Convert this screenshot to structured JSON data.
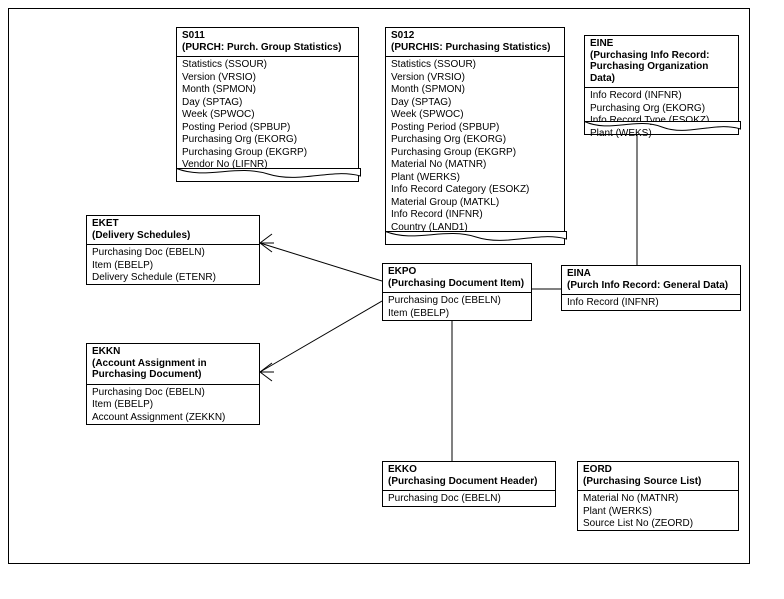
{
  "entities": {
    "s011": {
      "code": "S011",
      "title": "(PURCH: Purch. Group Statistics)",
      "fields": [
        "Statistics (SSOUR)",
        "Version (VRSIO)",
        "Month (SPMON)",
        "Day (SPTAG)",
        "Week (SPWOC)",
        "Posting Period (SPBUP)",
        "Purchasing Org (EKORG)",
        "Purchasing Group (EKGRP)",
        "Vendor No (LIFNR)"
      ]
    },
    "s012": {
      "code": "S012",
      "title": "(PURCHIS: Purchasing Statistics)",
      "fields": [
        "Statistics (SSOUR)",
        "Version (VRSIO)",
        "Month (SPMON)",
        "Day (SPTAG)",
        "Week (SPWOC)",
        "Posting Period (SPBUP)",
        "Purchasing Org (EKORG)",
        "Purchasing Group (EKGRP)",
        "Material No (MATNR)",
        "Plant (WERKS)",
        "Info Record Category (ESOKZ)",
        "Material Group (MATKL)",
        "Info Record (INFNR)",
        "Country (LAND1)"
      ]
    },
    "eine": {
      "code": "EINE",
      "title": "(Purchasing Info Record: Purchasing Organization Data)",
      "fields": [
        "Info Record (INFNR)",
        "Purchasing Org (EKORG)",
        "Info Record Type (ESOKZ)",
        "Plant (WEKS)"
      ]
    },
    "eket": {
      "code": "EKET",
      "title": "(Delivery Schedules)",
      "fields": [
        "Purchasing Doc (EBELN)",
        "Item (EBELP)",
        "Delivery Schedule (ETENR)"
      ]
    },
    "ekpo": {
      "code": "EKPO",
      "title": "(Purchasing Document Item)",
      "fields": [
        "Purchasing Doc (EBELN)",
        "Item (EBELP)"
      ]
    },
    "eina": {
      "code": "EINA",
      "title": "(Purch Info Record: General Data)",
      "fields": [
        "Info Record (INFNR)"
      ]
    },
    "ekkn": {
      "code": "EKKN",
      "title": "(Account Assignment in Purchasing Document)",
      "fields": [
        "Purchasing Doc (EBELN)",
        "Item (EBELP)",
        "Account Assignment (ZEKKN)"
      ]
    },
    "ekko": {
      "code": "EKKO",
      "title": "(Purchasing Document Header)",
      "fields": [
        "Purchasing Doc (EBELN)"
      ]
    },
    "eord": {
      "code": "EORD",
      "title": "(Purchasing Source List)",
      "fields": [
        "Material No (MATNR)",
        "Plant (WERKS)",
        "Source List No (ZEORD)"
      ]
    }
  }
}
